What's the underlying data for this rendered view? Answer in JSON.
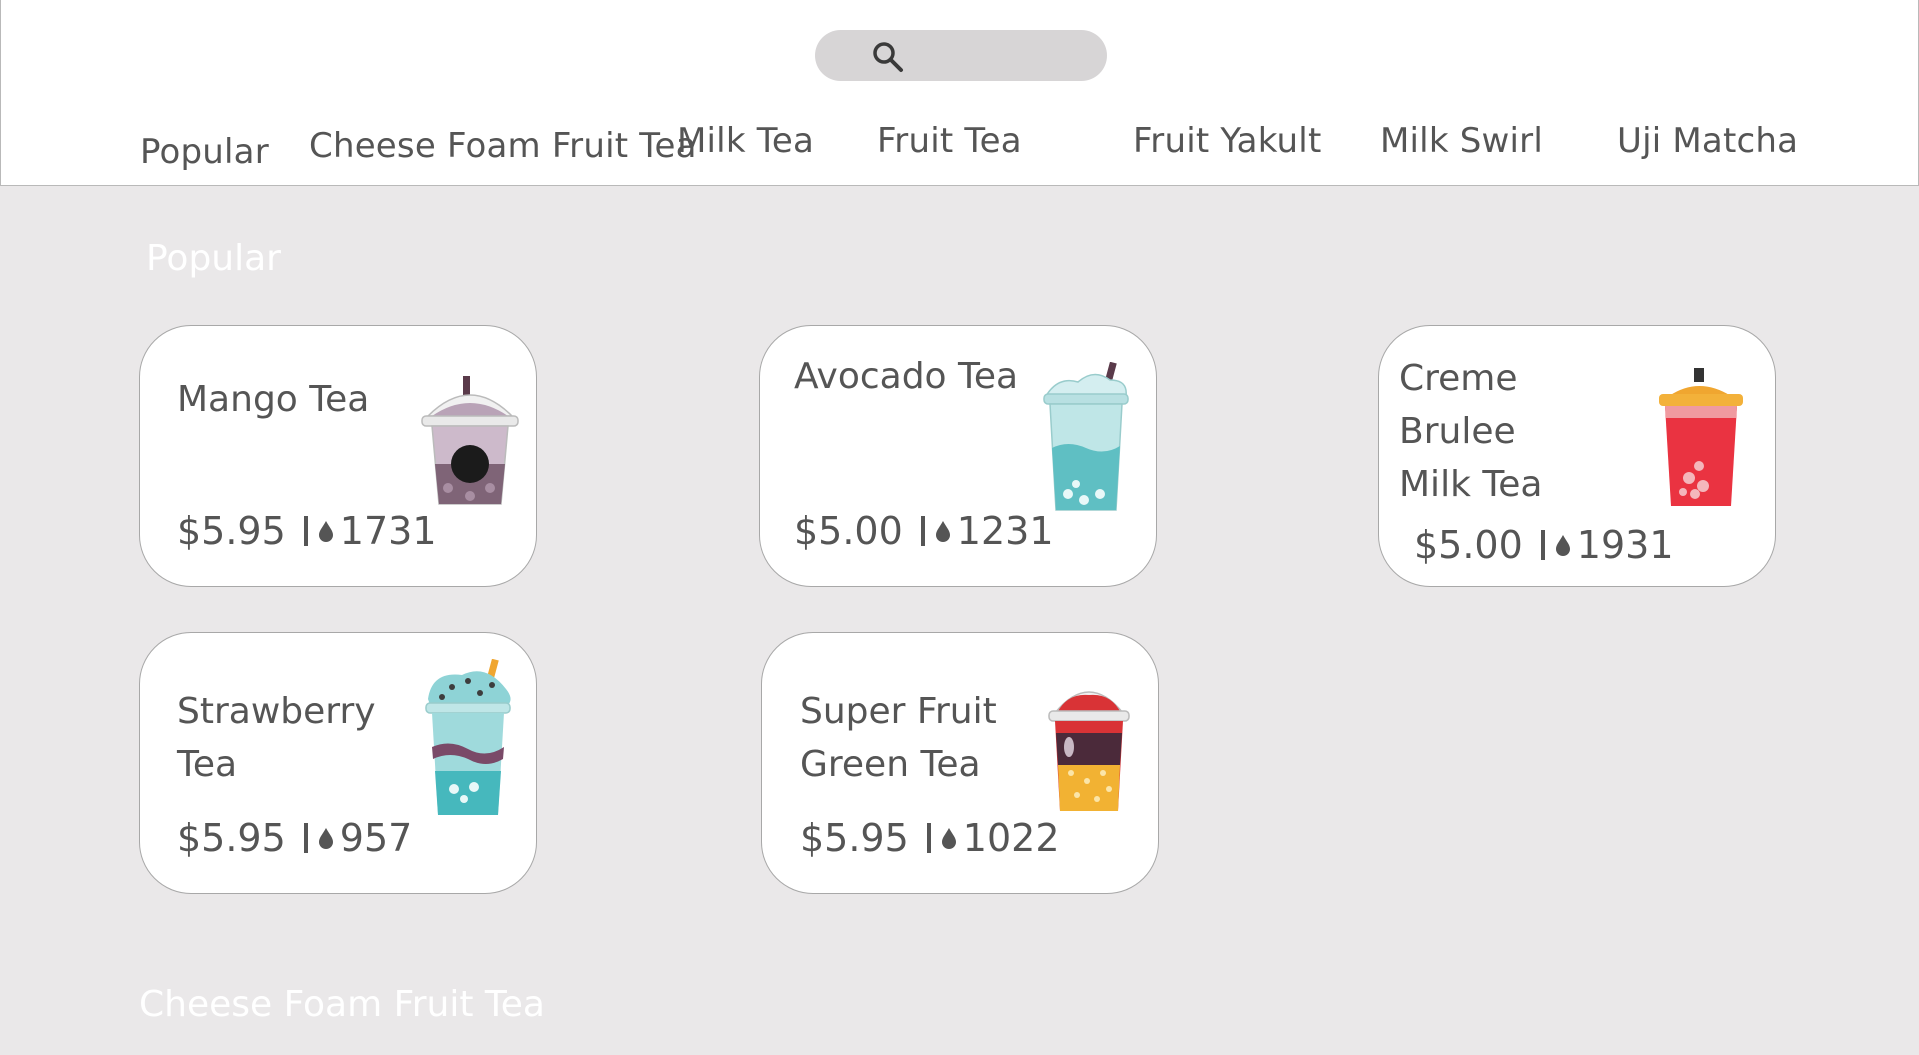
{
  "search": {
    "icon": "search-icon"
  },
  "nav": {
    "tabs": [
      {
        "label": "Popular"
      },
      {
        "label": "Cheese Foam Fruit Tea"
      },
      {
        "label": "Milk Tea"
      },
      {
        "label": "Fruit Tea"
      },
      {
        "label": "Fruit Yakult"
      },
      {
        "label": "Milk Swirl"
      },
      {
        "label": "Uji Matcha"
      }
    ]
  },
  "sections": {
    "popular": "Popular",
    "cheese_foam": "Cheese Foam Fruit Tea"
  },
  "products": [
    {
      "name": "Mango Tea",
      "price": "$5.95",
      "count": "1731",
      "icon": "drink-cup-icon"
    },
    {
      "name": "Avocado Tea",
      "price": "$5.00",
      "count": "1231",
      "icon": "drink-cup-icon"
    },
    {
      "name_line1": "Creme Brulee",
      "name_line2": "Milk Tea",
      "price": "$5.00",
      "count": "1931",
      "icon": "drink-cup-icon"
    },
    {
      "name_line1": "Strawberry",
      "name_line2": "Tea",
      "price": "$5.95",
      "count": "957",
      "icon": "drink-cup-icon"
    },
    {
      "name_line1": "Super Fruit",
      "name_line2": "Green Tea",
      "price": "$5.95",
      "count": "1022",
      "icon": "drink-cup-icon"
    }
  ],
  "colors": {
    "background": "#eae8e9",
    "card": "#ffffff",
    "text": "#555555",
    "section_title": "#ffffff"
  }
}
